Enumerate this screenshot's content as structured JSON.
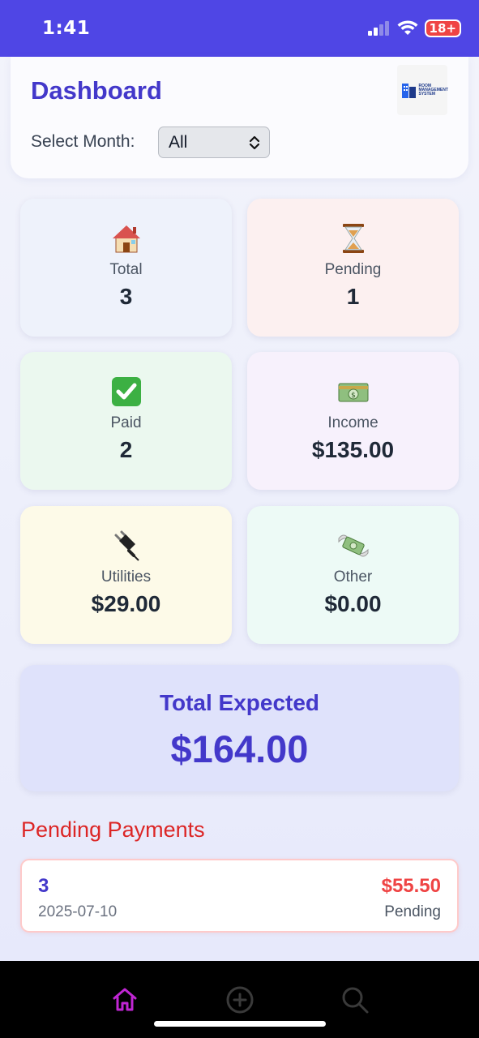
{
  "status_bar": {
    "time": "1:41",
    "battery": "18+"
  },
  "header": {
    "title": "Dashboard",
    "logo_text": "ROOM MANAGEMENT SYSTEM",
    "month_label": "Select Month:",
    "month_value": "All"
  },
  "stats": [
    {
      "label": "Total",
      "value": "3",
      "icon": "house-icon",
      "bg": "#eef2fb"
    },
    {
      "label": "Pending",
      "value": "1",
      "icon": "hourglass-icon",
      "bg": "#fcf0f0"
    },
    {
      "label": "Paid",
      "value": "2",
      "icon": "check-icon",
      "bg": "#ebf8ef"
    },
    {
      "label": "Income",
      "value": "$135.00",
      "icon": "money-icon",
      "bg": "#f7f1fc"
    },
    {
      "label": "Utilities",
      "value": "$29.00",
      "icon": "plug-icon",
      "bg": "#fdfae8"
    },
    {
      "label": "Other",
      "value": "$0.00",
      "icon": "money-wings-icon",
      "bg": "#edfaf6"
    }
  ],
  "expected": {
    "title": "Total Expected",
    "value": "$164.00"
  },
  "pending_section": {
    "title": "Pending Payments",
    "items": [
      {
        "room": "3",
        "date": "2025-07-10",
        "amount": "$55.50",
        "status": "Pending"
      }
    ]
  },
  "colors": {
    "primary": "#4f46e5",
    "accent_text": "#4338ca",
    "danger": "#ef4444",
    "tab_active": "#c026d3",
    "tab_inactive": "#3a3a3a"
  },
  "tabs": [
    {
      "icon": "home-icon",
      "active": true
    },
    {
      "icon": "add-circle-icon",
      "active": false
    },
    {
      "icon": "search-icon",
      "active": false
    }
  ]
}
